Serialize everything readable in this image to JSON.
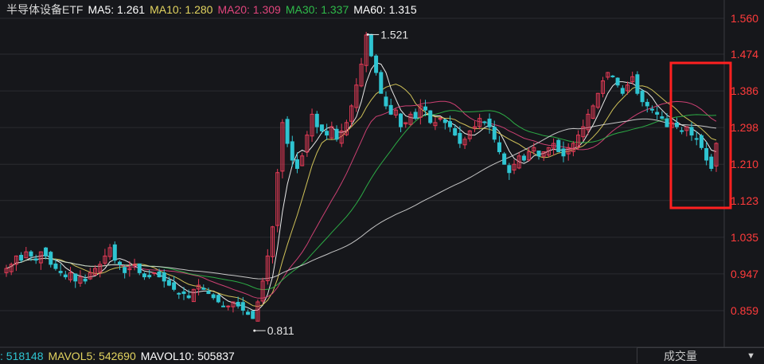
{
  "legend": {
    "name": "半导体设备ETF",
    "ma": [
      {
        "label": "MA5: 1.261",
        "color": "#ffffff"
      },
      {
        "label": "MA10: 1.280",
        "color": "#e2d35f"
      },
      {
        "label": "MA20: 1.309",
        "color": "#e0457c"
      },
      {
        "label": "MA30: 1.337",
        "color": "#2fbb4a"
      },
      {
        "label": "MA60: 1.315",
        "color": "#ffffff"
      }
    ]
  },
  "volume_legend": {
    "vol": ": 518148",
    "mavol5": "MAVOL5: 542690",
    "mavol10": "MAVOL10: 505837"
  },
  "indicator_select": {
    "label": "成交量",
    "caret": "▼"
  },
  "colors": {
    "up": "#e63b57",
    "down": "#2fc4d1",
    "tick": "#ff3b3b",
    "highlight": "#ff2020",
    "bg": "#16171b",
    "grid": "#2a2b30"
  },
  "chart_data": {
    "type": "candlestick",
    "y_ticks": [
      "1.560",
      "1.474",
      "1.386",
      "1.298",
      "1.210",
      "1.123",
      "1.035",
      "0.947",
      "0.859"
    ],
    "ylim": [
      0.811,
      1.56
    ],
    "annotations": [
      {
        "label": "1.521",
        "value": 1.521
      },
      {
        "label": "0.811",
        "value": 0.811
      }
    ],
    "series": [
      {
        "name": "MA5",
        "value": 1.261
      },
      {
        "name": "MA10",
        "value": 1.28
      },
      {
        "name": "MA20",
        "value": 1.309
      },
      {
        "name": "MA30",
        "value": 1.337
      },
      {
        "name": "MA60",
        "value": 1.315
      }
    ],
    "closes": [
      0.96,
      0.97,
      0.99,
      0.98,
      1.0,
      0.99,
      0.98,
      1.0,
      0.99,
      0.97,
      0.96,
      0.95,
      0.94,
      0.95,
      0.93,
      0.94,
      0.93,
      0.95,
      0.96,
      0.97,
      0.99,
      1.01,
      0.98,
      0.97,
      0.95,
      0.96,
      0.97,
      0.95,
      0.94,
      0.94,
      0.95,
      0.94,
      0.93,
      0.92,
      0.91,
      0.9,
      0.9,
      0.89,
      0.91,
      0.92,
      0.91,
      0.9,
      0.89,
      0.88,
      0.87,
      0.87,
      0.88,
      0.87,
      0.86,
      0.85,
      0.84,
      0.88,
      0.93,
      0.99,
      1.06,
      1.19,
      1.31,
      1.26,
      1.22,
      1.2,
      1.23,
      1.28,
      1.33,
      1.3,
      1.29,
      1.28,
      1.3,
      1.27,
      1.29,
      1.31,
      1.35,
      1.4,
      1.45,
      1.52,
      1.47,
      1.43,
      1.38,
      1.35,
      1.33,
      1.34,
      1.3,
      1.31,
      1.33,
      1.32,
      1.35,
      1.34,
      1.31,
      1.31,
      1.32,
      1.31,
      1.3,
      1.28,
      1.26,
      1.27,
      1.29,
      1.3,
      1.32,
      1.31,
      1.3,
      1.27,
      1.24,
      1.21,
      1.19,
      1.21,
      1.23,
      1.22,
      1.24,
      1.25,
      1.23,
      1.24,
      1.25,
      1.26,
      1.24,
      1.23,
      1.25,
      1.26,
      1.28,
      1.3,
      1.33,
      1.35,
      1.38,
      1.41,
      1.43,
      1.42,
      1.4,
      1.38,
      1.4,
      1.42,
      1.38,
      1.36,
      1.35,
      1.34,
      1.33,
      1.32,
      1.3,
      1.31,
      1.3,
      1.29,
      1.3,
      1.28,
      1.27,
      1.25,
      1.22,
      1.2,
      1.26
    ]
  }
}
